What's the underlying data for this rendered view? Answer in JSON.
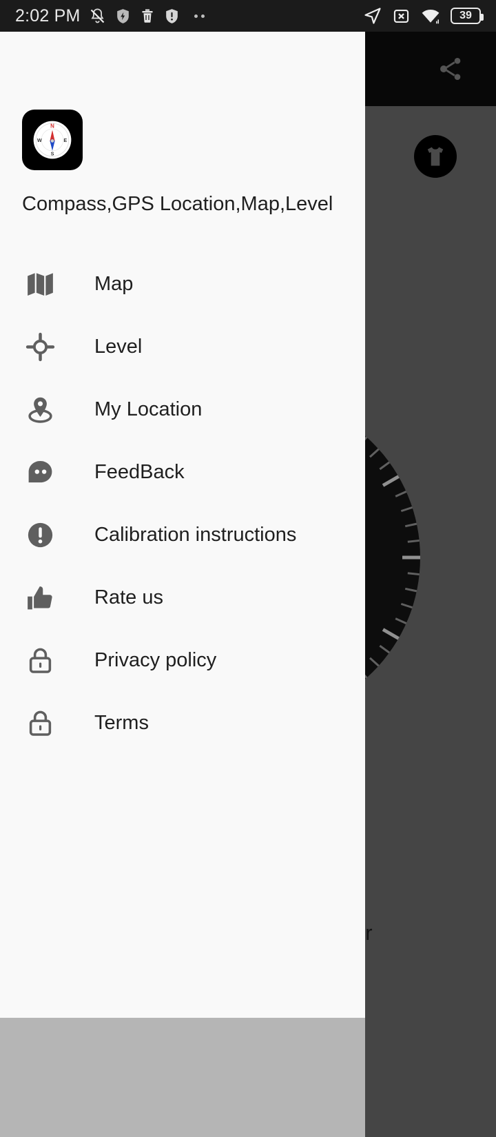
{
  "status_bar": {
    "time": "2:02 PM",
    "battery_percent": "39",
    "left_icons": [
      "bell-muted-icon",
      "shield-bolt-icon",
      "trash-icon",
      "shield-alert-icon",
      "overflow-dots-icon"
    ],
    "right_icons": [
      "location-arrow-icon",
      "sim-off-icon",
      "wifi-icon",
      "battery-icon"
    ]
  },
  "drawer": {
    "app_title": "Compass,GPS Location,Map,Level",
    "app_icon": "compass-app-icon",
    "compass_labels": {
      "north": "N",
      "east": "E",
      "south": "S",
      "west": "W"
    },
    "items": [
      {
        "label": "Map",
        "icon": "map-icon"
      },
      {
        "label": "Level",
        "icon": "crosshair-icon"
      },
      {
        "label": "My Location",
        "icon": "location-pin-icon"
      },
      {
        "label": "FeedBack",
        "icon": "speech-bubble-icon"
      },
      {
        "label": "Calibration instructions",
        "icon": "exclamation-circle-icon"
      },
      {
        "label": "Rate us",
        "icon": "thumbs-up-icon"
      },
      {
        "label": "Privacy policy",
        "icon": "lock-icon"
      },
      {
        "label": "Terms",
        "icon": "lock-icon"
      }
    ]
  },
  "app": {
    "share_icon": "share-icon",
    "theme_icon": "tshirt-icon",
    "place_label": "mpur",
    "dial": "compass-dial"
  },
  "colors": {
    "drawer_bg": "#f9f9f9",
    "status_bar_bg": "#1b1b1b",
    "app_bar_bg": "#0d0d0d",
    "icon_gray": "#5f5f5f",
    "text_dark": "#1f1f1f",
    "dial_dark": "#141414",
    "scrim": "#666666",
    "bottom_bar": "#b5b5b5",
    "needle_north": "#d32f2f",
    "needle_south": "#1e49c7"
  }
}
